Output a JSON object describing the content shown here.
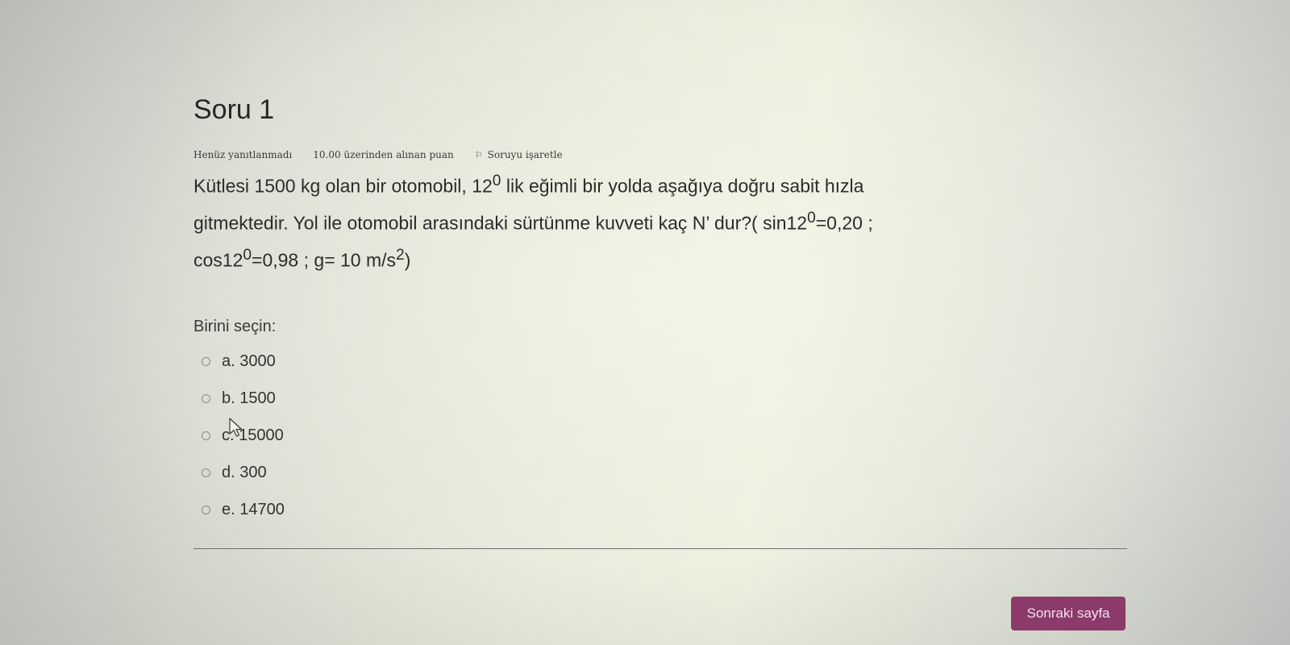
{
  "question": {
    "title": "Soru 1",
    "status": "Henüz yanıtlanmadı",
    "grade": "10.00 üzerinden alınan puan",
    "flag_label": "Soruyu işaretle",
    "text_line1": "Kütlesi 1500 kg olan bir otomobil, 12",
    "sup_1": "0",
    "text_line1_rest": " lik eğimli bir yolda aşağıya doğru sabit hızla",
    "text_line2": "gitmektedir. Yol ile otomobil arasındaki sürtünme kuvveti kaç N’ dur?( sin12",
    "sup_2": "0",
    "text_line2_rest": "=0,20 ;",
    "text_line3": "cos12",
    "sup_3": "0",
    "text_line3_mid": "=0,98  ; g= 10 m/s",
    "sup_4": "2",
    "text_line3_end": ")",
    "prompt": "Birini seçin:",
    "options": [
      {
        "label": "a. 3000"
      },
      {
        "label": "b. 1500"
      },
      {
        "label": "c. 15000"
      },
      {
        "label": "d. 300"
      },
      {
        "label": "e. 14700"
      }
    ]
  },
  "navigation": {
    "next_label": "Sonraki sayfa"
  },
  "icons": {
    "flag": "flag-icon",
    "cursor": "mouse-pointer-icon"
  },
  "colors": {
    "button_bg": "#8b3a6a",
    "button_text": "#f0e3ec"
  }
}
